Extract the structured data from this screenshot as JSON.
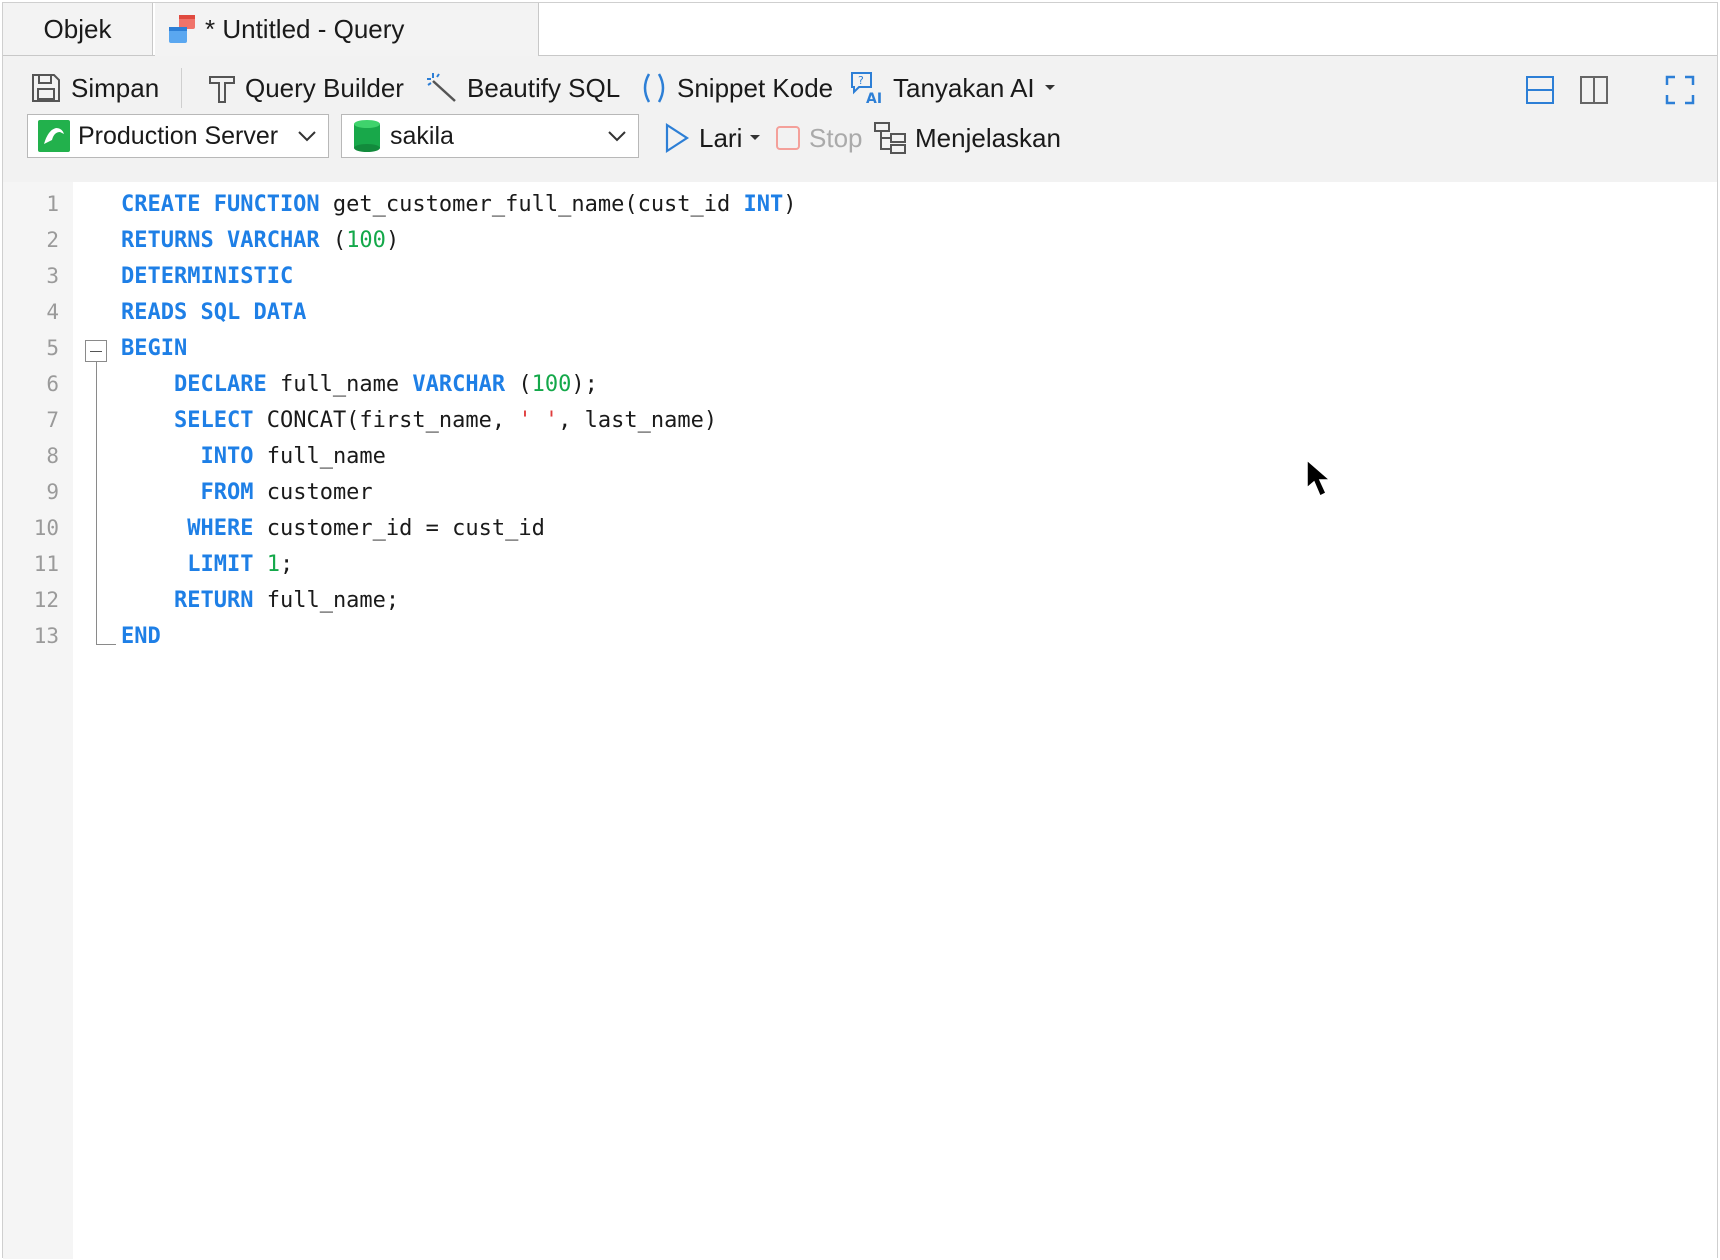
{
  "tabs": {
    "objek": "Objek",
    "query": "* Untitled - Query"
  },
  "toolbar": {
    "save": "Simpan",
    "query_builder": "Query Builder",
    "beautify": "Beautify SQL",
    "snippet": "Snippet Kode",
    "ask_ai": "Tanyakan AI",
    "run": "Lari",
    "stop": "Stop",
    "explain": "Menjelaskan"
  },
  "connection": {
    "server": "Production Server",
    "database": "sakila"
  },
  "colors": {
    "keyword": "#1e7fe6",
    "number": "#14a84a",
    "string": "#e03c3c",
    "server_icon": "#22b14c"
  },
  "editor": {
    "line_numbers": [
      "1",
      "2",
      "3",
      "4",
      "5",
      "6",
      "7",
      "8",
      "9",
      "10",
      "11",
      "12",
      "13"
    ],
    "lines": [
      [
        {
          "t": "CREATE FUNCTION",
          "c": "kw"
        },
        {
          "t": " get_customer_full_name(cust_id ",
          "c": ""
        },
        {
          "t": "INT",
          "c": "kw"
        },
        {
          "t": ")",
          "c": ""
        }
      ],
      [
        {
          "t": "RETURNS VARCHAR",
          "c": "kw"
        },
        {
          "t": " (",
          "c": ""
        },
        {
          "t": "100",
          "c": "num"
        },
        {
          "t": ")",
          "c": ""
        }
      ],
      [
        {
          "t": "DETERMINISTIC",
          "c": "kw"
        }
      ],
      [
        {
          "t": "READS SQL DATA",
          "c": "kw"
        }
      ],
      [
        {
          "t": "BEGIN",
          "c": "kw"
        }
      ],
      [
        {
          "t": "    ",
          "c": ""
        },
        {
          "t": "DECLARE",
          "c": "kw"
        },
        {
          "t": " full_name ",
          "c": ""
        },
        {
          "t": "VARCHAR",
          "c": "kw"
        },
        {
          "t": " (",
          "c": ""
        },
        {
          "t": "100",
          "c": "num"
        },
        {
          "t": ");",
          "c": ""
        }
      ],
      [
        {
          "t": "    ",
          "c": ""
        },
        {
          "t": "SELECT",
          "c": "kw"
        },
        {
          "t": " CONCAT(first_name, ",
          "c": ""
        },
        {
          "t": "' '",
          "c": "str"
        },
        {
          "t": ", last_name)",
          "c": ""
        }
      ],
      [
        {
          "t": "      ",
          "c": ""
        },
        {
          "t": "INTO",
          "c": "kw"
        },
        {
          "t": " full_name",
          "c": ""
        }
      ],
      [
        {
          "t": "      ",
          "c": ""
        },
        {
          "t": "FROM",
          "c": "kw"
        },
        {
          "t": " customer",
          "c": ""
        }
      ],
      [
        {
          "t": "     ",
          "c": ""
        },
        {
          "t": "WHERE",
          "c": "kw"
        },
        {
          "t": " customer_id = cust_id",
          "c": ""
        }
      ],
      [
        {
          "t": "     ",
          "c": ""
        },
        {
          "t": "LIMIT",
          "c": "kw"
        },
        {
          "t": " ",
          "c": ""
        },
        {
          "t": "1",
          "c": "num"
        },
        {
          "t": ";",
          "c": ""
        }
      ],
      [
        {
          "t": "    ",
          "c": ""
        },
        {
          "t": "RETURN",
          "c": "kw"
        },
        {
          "t": " full_name;",
          "c": ""
        }
      ],
      [
        {
          "t": "END",
          "c": "kw"
        }
      ]
    ]
  }
}
